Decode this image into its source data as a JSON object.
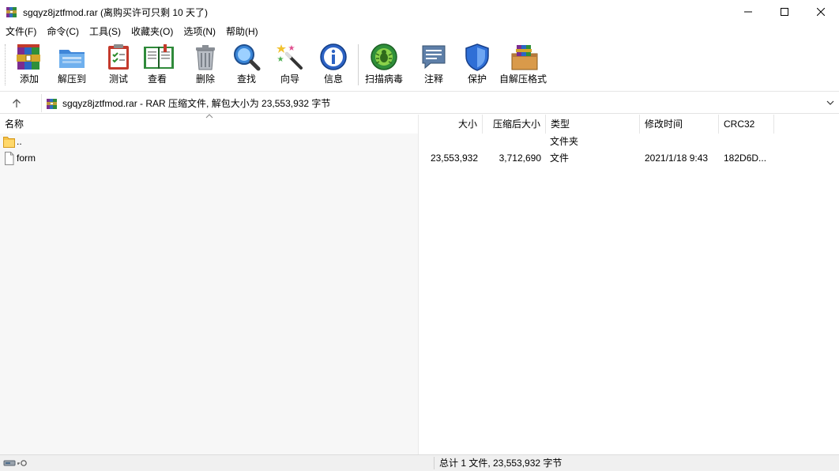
{
  "window": {
    "title": "sgqyz8jztfmod.rar (离购买许可只剩 10 天了)",
    "controls": [
      "minimize",
      "maximize",
      "close"
    ]
  },
  "menu": [
    {
      "label": "文件(F)"
    },
    {
      "label": "命令(C)"
    },
    {
      "label": "工具(S)"
    },
    {
      "label": "收藏夹(O)"
    },
    {
      "label": "选项(N)"
    },
    {
      "label": "帮助(H)"
    }
  ],
  "toolbar": [
    {
      "label": "添加",
      "icon": "add-archive-icon"
    },
    {
      "label": "解压到",
      "icon": "extract-folder-icon"
    },
    {
      "label": "测试",
      "icon": "test-clipboard-icon"
    },
    {
      "label": "查看",
      "icon": "view-book-icon"
    },
    {
      "label": "删除",
      "icon": "trash-icon"
    },
    {
      "label": "查找",
      "icon": "magnifier-icon"
    },
    {
      "label": "向导",
      "icon": "wizard-wand-icon"
    },
    {
      "label": "信息",
      "icon": "info-icon"
    },
    {
      "label": "扫描病毒",
      "icon": "virus-scan-icon"
    },
    {
      "label": "注释",
      "icon": "comment-icon"
    },
    {
      "label": "保护",
      "icon": "shield-icon"
    },
    {
      "label": "自解压格式",
      "icon": "sfx-box-icon"
    }
  ],
  "address": {
    "text": "sgqyz8jztfmod.rar - RAR 压缩文件, 解包大小为 23,553,932 字节"
  },
  "columns": {
    "name": "名称",
    "size": "大小",
    "packed": "压缩后大小",
    "type": "类型",
    "modified": "修改时间",
    "crc": "CRC32"
  },
  "rows": [
    {
      "name": "..",
      "size": "",
      "packed": "",
      "type": "文件夹",
      "modified": "",
      "crc": "",
      "icon": "folder-icon"
    },
    {
      "name": "form",
      "size": "23,553,932",
      "packed": "3,712,690",
      "type": "文件",
      "modified": "2021/1/18 9:43",
      "crc": "182D6D...",
      "icon": "file-icon"
    }
  ],
  "status": {
    "text": "总计 1 文件, 23,553,932 字节"
  }
}
